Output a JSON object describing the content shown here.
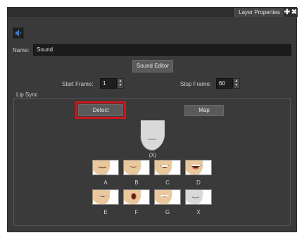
{
  "titlebar": {
    "tab_label": "Layer Properties",
    "add_icon": "plus-icon",
    "close_icon": "close-icon"
  },
  "sound_button": {
    "icon": "speaker-icon"
  },
  "name_field": {
    "label": "Name:",
    "value": "Sound"
  },
  "sound_editor_button": {
    "label": "Sound Editor"
  },
  "start_frame": {
    "label": "Start Frame:",
    "value": "1"
  },
  "stop_frame": {
    "label": "Stop Frame:",
    "value": "60"
  },
  "lip_sync": {
    "group_label": "Lip Sync",
    "detect_label": "Detect",
    "map_label": "Map",
    "current_label": "(X)",
    "mouths": [
      {
        "label": "A"
      },
      {
        "label": "B"
      },
      {
        "label": "C"
      },
      {
        "label": "D"
      },
      {
        "label": "E"
      },
      {
        "label": "F"
      },
      {
        "label": "G"
      },
      {
        "label": "X"
      }
    ]
  },
  "colors": {
    "panel": "#3a3a3a",
    "highlight": "#d0151b",
    "speaker_accent": "#2f7fd8"
  }
}
